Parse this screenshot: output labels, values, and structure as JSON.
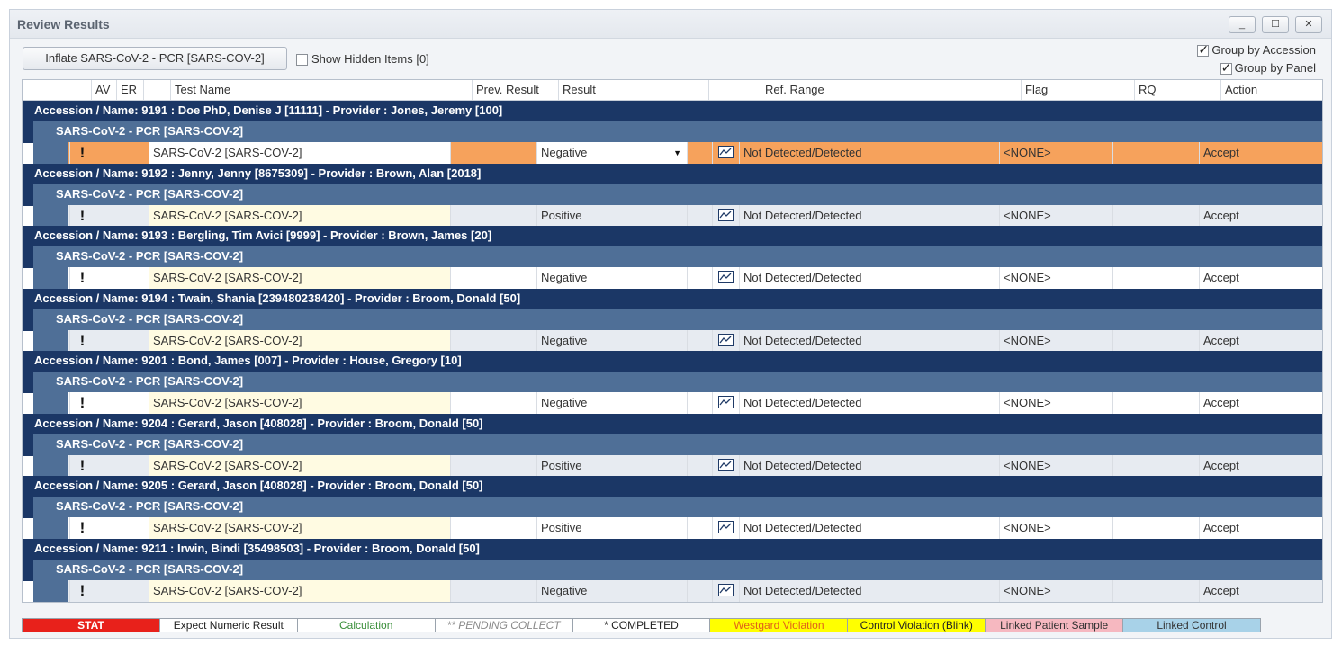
{
  "window": {
    "title": "Review Results",
    "min_glyph": "_",
    "max_glyph": "☐",
    "close_glyph": "✕"
  },
  "toolbar": {
    "inflate_label": "Inflate SARS-CoV-2 - PCR [SARS-COV-2]",
    "show_hidden_label": "Show Hidden Items [0]",
    "group_by_accession_label": "Group by Accession",
    "group_by_panel_label": "Group by Panel"
  },
  "columns": {
    "av": "AV",
    "er": "ER",
    "test_name": "Test Name",
    "prev_result": "Prev. Result",
    "result": "Result",
    "ref_range": "Ref. Range",
    "flag": "Flag",
    "rq": "RQ",
    "action": "Action"
  },
  "groups": [
    {
      "accession": "Accession / Name: 9191 : Doe PhD, Denise J [11111] - Provider : Jones, Jeremy [100]",
      "panel": "SARS-CoV-2 - PCR [SARS-COV-2]",
      "row": {
        "excl": "!",
        "test": "SARS-CoV-2 [SARS-COV-2]",
        "prev": "",
        "result": "Negative",
        "ref": "Not Detected/Detected",
        "flag": "<NONE>",
        "rq": "",
        "action": "Accept",
        "selected": true
      }
    },
    {
      "accession": "Accession / Name: 9192 : Jenny, Jenny [8675309] - Provider : Brown, Alan [2018]",
      "panel": "SARS-CoV-2 - PCR [SARS-COV-2]",
      "row": {
        "excl": "!",
        "test": "SARS-CoV-2 [SARS-COV-2]",
        "prev": "",
        "result": "Positive",
        "ref": "Not Detected/Detected",
        "flag": "<NONE>",
        "rq": "",
        "action": "Accept"
      }
    },
    {
      "accession": "Accession / Name: 9193 : Bergling, Tim Avici [9999] - Provider : Brown, James [20]",
      "panel": "SARS-CoV-2 - PCR [SARS-COV-2]",
      "row": {
        "excl": "!",
        "test": "SARS-CoV-2 [SARS-COV-2]",
        "prev": "",
        "result": "Negative",
        "ref": "Not Detected/Detected",
        "flag": "<NONE>",
        "rq": "",
        "action": "Accept"
      }
    },
    {
      "accession": "Accession / Name: 9194 : Twain, Shania [239480238420] - Provider : Broom, Donald [50]",
      "panel": "SARS-CoV-2 - PCR [SARS-COV-2]",
      "row": {
        "excl": "!",
        "test": "SARS-CoV-2 [SARS-COV-2]",
        "prev": "",
        "result": "Negative",
        "ref": "Not Detected/Detected",
        "flag": "<NONE>",
        "rq": "",
        "action": "Accept"
      }
    },
    {
      "accession": "Accession / Name: 9201 : Bond, James [007] - Provider : House, Gregory [10]",
      "panel": "SARS-CoV-2 - PCR [SARS-COV-2]",
      "row": {
        "excl": "!",
        "test": "SARS-CoV-2 [SARS-COV-2]",
        "prev": "",
        "result": "Negative",
        "ref": "Not Detected/Detected",
        "flag": "<NONE>",
        "rq": "",
        "action": "Accept"
      }
    },
    {
      "accession": "Accession / Name: 9204 : Gerard, Jason [408028] - Provider : Broom, Donald [50]",
      "panel": "SARS-CoV-2 - PCR [SARS-COV-2]",
      "row": {
        "excl": "!",
        "test": "SARS-CoV-2 [SARS-COV-2]",
        "prev": "",
        "result": "Positive",
        "ref": "Not Detected/Detected",
        "flag": "<NONE>",
        "rq": "",
        "action": "Accept"
      }
    },
    {
      "accession": "Accession / Name: 9205 : Gerard, Jason [408028] - Provider : Broom, Donald [50]",
      "panel": "SARS-CoV-2 - PCR [SARS-COV-2]",
      "row": {
        "excl": "!",
        "test": "SARS-CoV-2 [SARS-COV-2]",
        "prev": "",
        "result": "Positive",
        "ref": "Not Detected/Detected",
        "flag": "<NONE>",
        "rq": "",
        "action": "Accept"
      }
    },
    {
      "accession": "Accession / Name: 9211 : Irwin, Bindi [35498503] - Provider : Broom, Donald [50]",
      "panel": "SARS-CoV-2 - PCR [SARS-COV-2]",
      "row": {
        "excl": "!",
        "test": "SARS-CoV-2 [SARS-COV-2]",
        "prev": "",
        "result": "Negative",
        "ref": "Not Detected/Detected",
        "flag": "<NONE>",
        "rq": "",
        "action": "Accept"
      }
    }
  ],
  "legend": [
    {
      "label": "STAT",
      "bg": "#e8211b",
      "fg": "#ffffff",
      "bold": true
    },
    {
      "label": "Expect Numeric Result",
      "bg": "#ffffff",
      "fg": "#222222"
    },
    {
      "label": "Calculation",
      "bg": "#ffffff",
      "fg": "#3a8f3a"
    },
    {
      "label": "** PENDING COLLECT",
      "bg": "#ffffff",
      "fg": "#8a8a8a",
      "italic": true
    },
    {
      "label": "* COMPLETED",
      "bg": "#ffffff",
      "fg": "#222222"
    },
    {
      "label": "Westgard Violation",
      "bg": "#ffff00",
      "fg": "#e0601a"
    },
    {
      "label": "Control Violation (Blink)",
      "bg": "#ffff00",
      "fg": "#222222"
    },
    {
      "label": "Linked Patient Sample",
      "bg": "#f6b8c0",
      "fg": "#333333"
    },
    {
      "label": "Linked Control",
      "bg": "#a8d2e8",
      "fg": "#333333"
    }
  ],
  "colors": {
    "accession_bg": "#1b3766",
    "panel_bg": "#4f6f97",
    "row_alt_bg": "#e7ebf1",
    "selected_bg": "#f6a25c",
    "test_name_bg": "#fffbe2"
  }
}
